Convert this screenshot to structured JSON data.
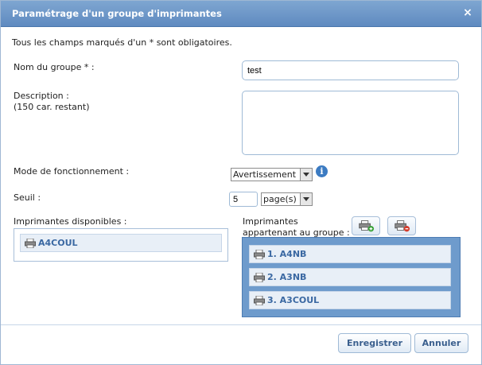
{
  "dialog": {
    "title": "Paramétrage d'un groupe d'imprimantes",
    "close_symbol": "×"
  },
  "intro": "Tous les champs marqués d'un * sont obligatoires.",
  "fields": {
    "name_label": "Nom du groupe * :",
    "name_value": "test",
    "description_label": "Description :",
    "description_hint": "(150 car. restant)",
    "description_value": "",
    "mode_label": "Mode de fonctionnement :",
    "mode_value": "Avertissement",
    "threshold_label": "Seuil :",
    "threshold_value": "5",
    "threshold_unit": "page(s)"
  },
  "available": {
    "label": "Imprimantes disponibles :",
    "items": [
      "A4COUL"
    ]
  },
  "group": {
    "label_line1": "Imprimantes",
    "label_line2": "appartenant au groupe :",
    "items": [
      "1. A4NB",
      "2. A3NB",
      "3. A3COUL"
    ]
  },
  "buttons": {
    "save": "Enregistrer",
    "cancel": "Annuler"
  },
  "icons": {
    "info": "info-icon",
    "printer": "printer-icon",
    "add": "add-printer-icon",
    "remove": "remove-printer-icon"
  },
  "colors": {
    "titlebar": "#6b94c8",
    "accent": "#3a68a2",
    "group_panel": "#6e9bcc"
  }
}
